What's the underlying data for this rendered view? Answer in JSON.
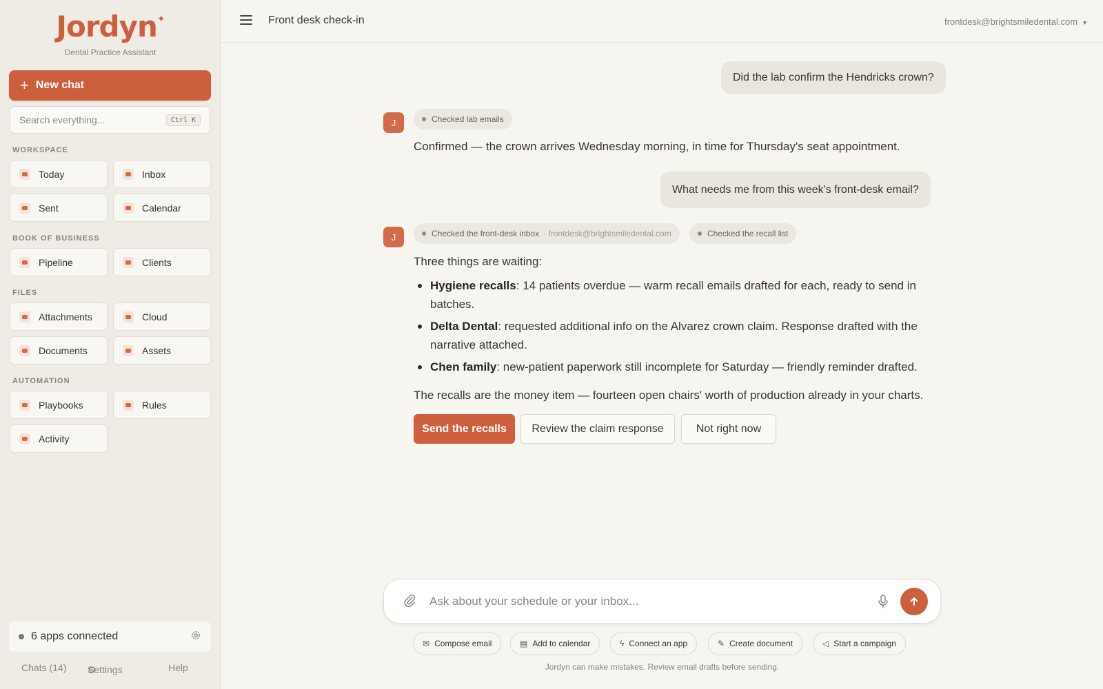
{
  "sidebar": {
    "logo": "Jordyn",
    "logo_subtitle": "Dental Practice Assistant",
    "new_chat_label": "New chat",
    "search_placeholder": "Search everything...",
    "search_shortcut": "Ctrl K",
    "sections": {
      "workspace": "WORKSPACE",
      "book_of_business": "BOOK OF BUSINESS",
      "files": "FILES",
      "automation": "AUTOMATION"
    },
    "items": {
      "today": "Today",
      "inbox": "Inbox",
      "sent": "Sent",
      "calendar": "Calendar",
      "pipeline": "Pipeline",
      "clients": "Clients",
      "attachments": "Attachments",
      "cloud": "Cloud",
      "documents": "Documents",
      "assets": "Assets",
      "playbooks": "Playbooks",
      "rules": "Rules",
      "activity": "Activity"
    },
    "apps_connected": "6 apps connected",
    "footer": {
      "chats": "Chats (14)",
      "settings": "Settings",
      "help": "Help"
    }
  },
  "header": {
    "title": "Front desk check-in",
    "account": "frontdesk@brightsmiledental.com"
  },
  "chat": {
    "user_msg_1": "Did the lab confirm the Hendricks crown?",
    "avatar_letter": "J",
    "chip_1": "Checked lab emails",
    "assistant_reply_1": "Confirmed — the crown arrives Wednesday morning, in time for Thursday's seat appointment.",
    "user_msg_2": "What needs me from this week's front-desk email?",
    "chip_2": "Checked the front-desk inbox",
    "chip_2_sub": "· frontdesk@brightsmiledental.com",
    "chip_3": "Checked the recall list",
    "intro": "Three things are waiting:",
    "bullets": [
      {
        "title": "Hygiene recalls",
        "text": ": 14 patients overdue — warm recall emails drafted for each, ready to send in batches."
      },
      {
        "title": "Delta Dental",
        "text": ": requested additional info on the Alvarez crown claim. Response drafted with the narrative attached."
      },
      {
        "title": "Chen family",
        "text": ": new-patient paperwork still incomplete for Saturday — friendly reminder drafted."
      }
    ],
    "summary": "The recalls are the money item — fourteen open chairs' worth of production already in your charts.",
    "actions": {
      "primary": "Send the recalls",
      "review": "Review the claim response",
      "dismiss": "Not right now"
    }
  },
  "composer": {
    "placeholder": "Ask about your schedule or your inbox...",
    "quick_actions": {
      "compose": "Compose email",
      "calendar": "Add to calendar",
      "connect": "Connect an app",
      "document": "Create document",
      "campaign": "Start a campaign"
    },
    "disclaimer": "Jordyn can make mistakes. Review email drafts before sending."
  },
  "colors": {
    "accent": "#cc5f3e",
    "background": "#f7f5f0",
    "sidebar": "#efece5"
  }
}
